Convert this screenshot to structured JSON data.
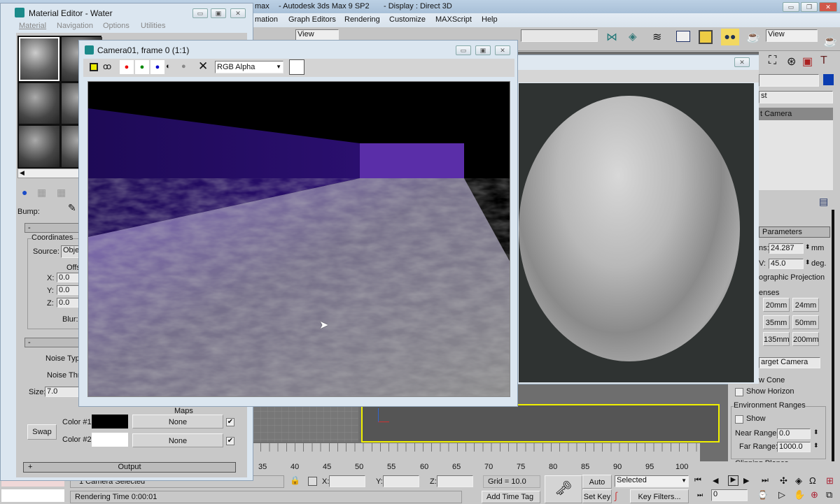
{
  "main": {
    "title_partial": "max",
    "title": "- Autodesk 3ds Max 9 SP2",
    "display": "- Display : Direct 3D",
    "menu": [
      "mation",
      "Graph Editors",
      "Rendering",
      "Customize",
      "MAXScript",
      "Help"
    ],
    "toolbar": {
      "view1": "View",
      "view2": "View"
    }
  },
  "material_editor": {
    "title": "Material Editor - Water",
    "menu": [
      "Material",
      "Navigation",
      "Options",
      "Utilities"
    ],
    "bump_label": "Bump:",
    "coords": {
      "rollout": "-",
      "group": "Coordinates",
      "source_label": "Source:",
      "source_value": "Obje",
      "offset_label": "Offs",
      "x_label": "X:",
      "x": "0.0",
      "y_label": "Y:",
      "y": "0.0",
      "z_label": "Z:",
      "z": "0.0",
      "blur_label": "Blur:"
    },
    "noise": {
      "rollout": "-",
      "type_label": "Noise Typ",
      "threshold_label": "Noise Thr",
      "size_label": "Size:",
      "size": "7.0"
    },
    "maps_label": "Maps",
    "color1_label": "Color #1",
    "color2_label": "Color #2",
    "map1": "None",
    "map2": "None",
    "swap": "Swap",
    "output_rollout": "Output",
    "output_plus": "+"
  },
  "render_window": {
    "title": "Camera01, frame 0 (1:1)",
    "channel": "RGB Alpha"
  },
  "command_panel": {
    "list_partial": "st",
    "camera_partial": "t Camera",
    "parameters": "Parameters",
    "lens_label": "ns:",
    "lens": "24.287",
    "lens_unit": "mm",
    "fov_label": "V:",
    "fov": "45.0",
    "fov_unit": "deg.",
    "ortho": "ographic Projection",
    "stock_lenses": "enses",
    "lenses": [
      "20mm",
      "24mm",
      "35mm",
      "50mm",
      "135mm",
      "200mm"
    ],
    "type": "arget Camera",
    "show_cone": "w Cone",
    "show_horizon": "Show Horizon",
    "env_ranges": "Environment Ranges",
    "env_show": "Show",
    "near_label": "Near Range:",
    "near": "0.0",
    "far_label": "Far Range:",
    "far": "1000.0",
    "clipping": "Clipping Planes"
  },
  "timeline": {
    "ticks": [
      "35",
      "40",
      "45",
      "50",
      "55",
      "60",
      "65",
      "70",
      "75",
      "80",
      "85",
      "90",
      "95",
      "100"
    ]
  },
  "status": {
    "selected": "1 Camera Selected",
    "render_time": "Rendering Time  0:00:01",
    "x_label": "X:",
    "y_label": "Y:",
    "z_label": "Z:",
    "grid": "Grid = 10.0",
    "add_time_tag": "Add Time Tag",
    "auto_key": "Auto Key",
    "set_key": "Set Key",
    "key_mode": "Selected",
    "key_filters": "Key Filters...",
    "frame": "0"
  },
  "colors": {
    "accent_blue": "#0a3cb0",
    "viewport_border": "#f0f000",
    "color1": "#000000",
    "color2": "#ffffff"
  }
}
